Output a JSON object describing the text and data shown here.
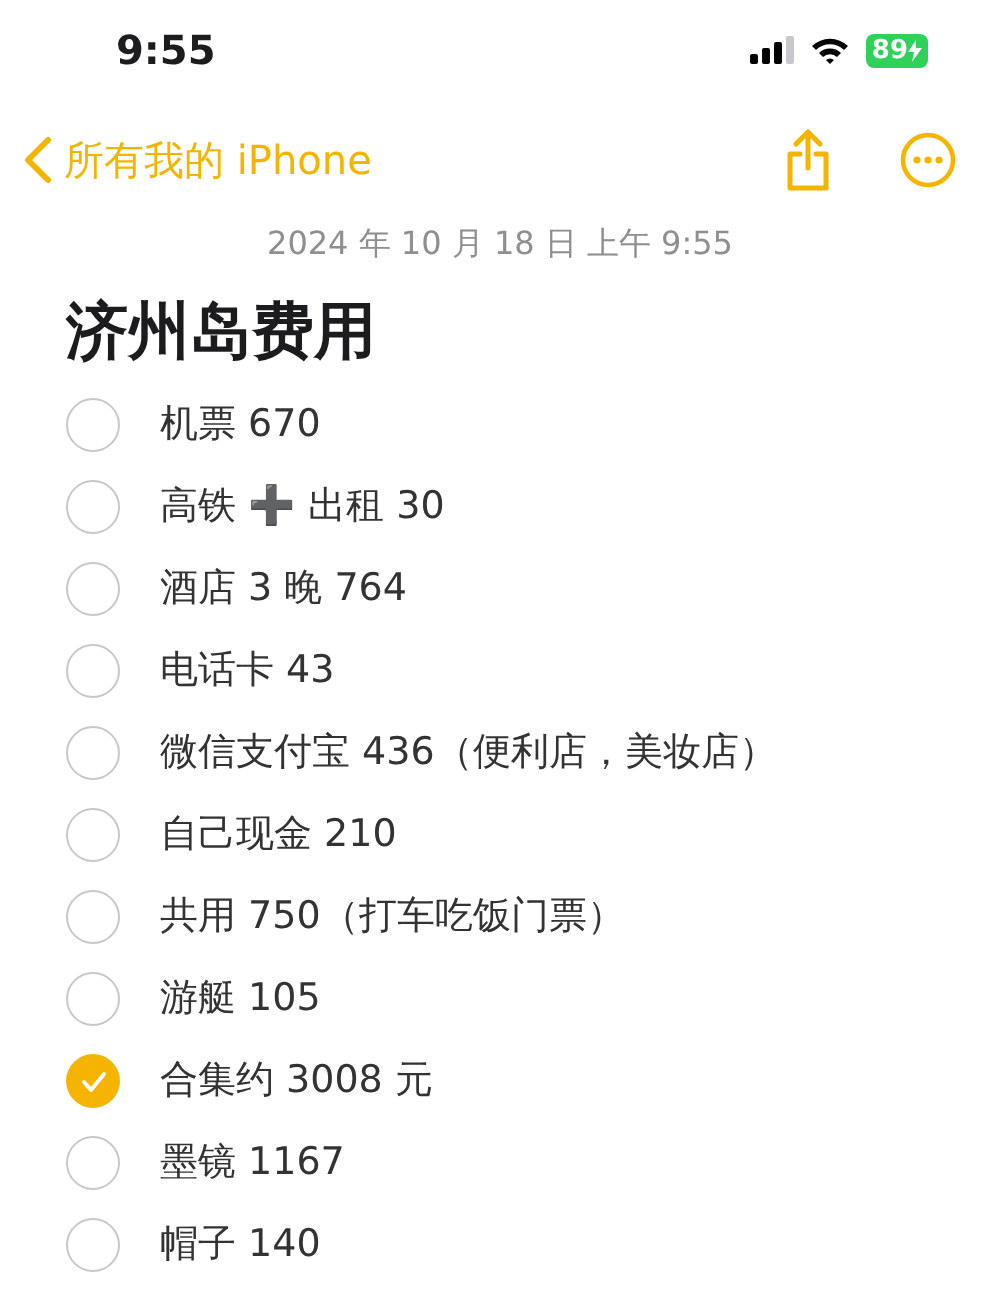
{
  "status_bar": {
    "time": "9:55",
    "battery": "89"
  },
  "nav": {
    "back_label": "所有我的 iPhone"
  },
  "note": {
    "date": "2024 年 10 月 18 日 上午 9:55",
    "title": "济州岛费用",
    "checklist": [
      {
        "text": "机票 670",
        "checked": false
      },
      {
        "text": "高铁 ➕ 出租 30",
        "checked": false
      },
      {
        "text": "酒店 3 晚 764",
        "checked": false
      },
      {
        "text": "电话卡 43",
        "checked": false
      },
      {
        "text": "微信支付宝 436（便利店，美妆店）",
        "checked": false
      },
      {
        "text": "自己现金 210",
        "checked": false
      },
      {
        "text": "共用 750（打车吃饭门票）",
        "checked": false
      },
      {
        "text": "游艇 105",
        "checked": false
      },
      {
        "text": "合集约 3008 元",
        "checked": true
      },
      {
        "text": "墨镜 1167",
        "checked": false
      },
      {
        "text": "帽子 140",
        "checked": false
      }
    ]
  }
}
